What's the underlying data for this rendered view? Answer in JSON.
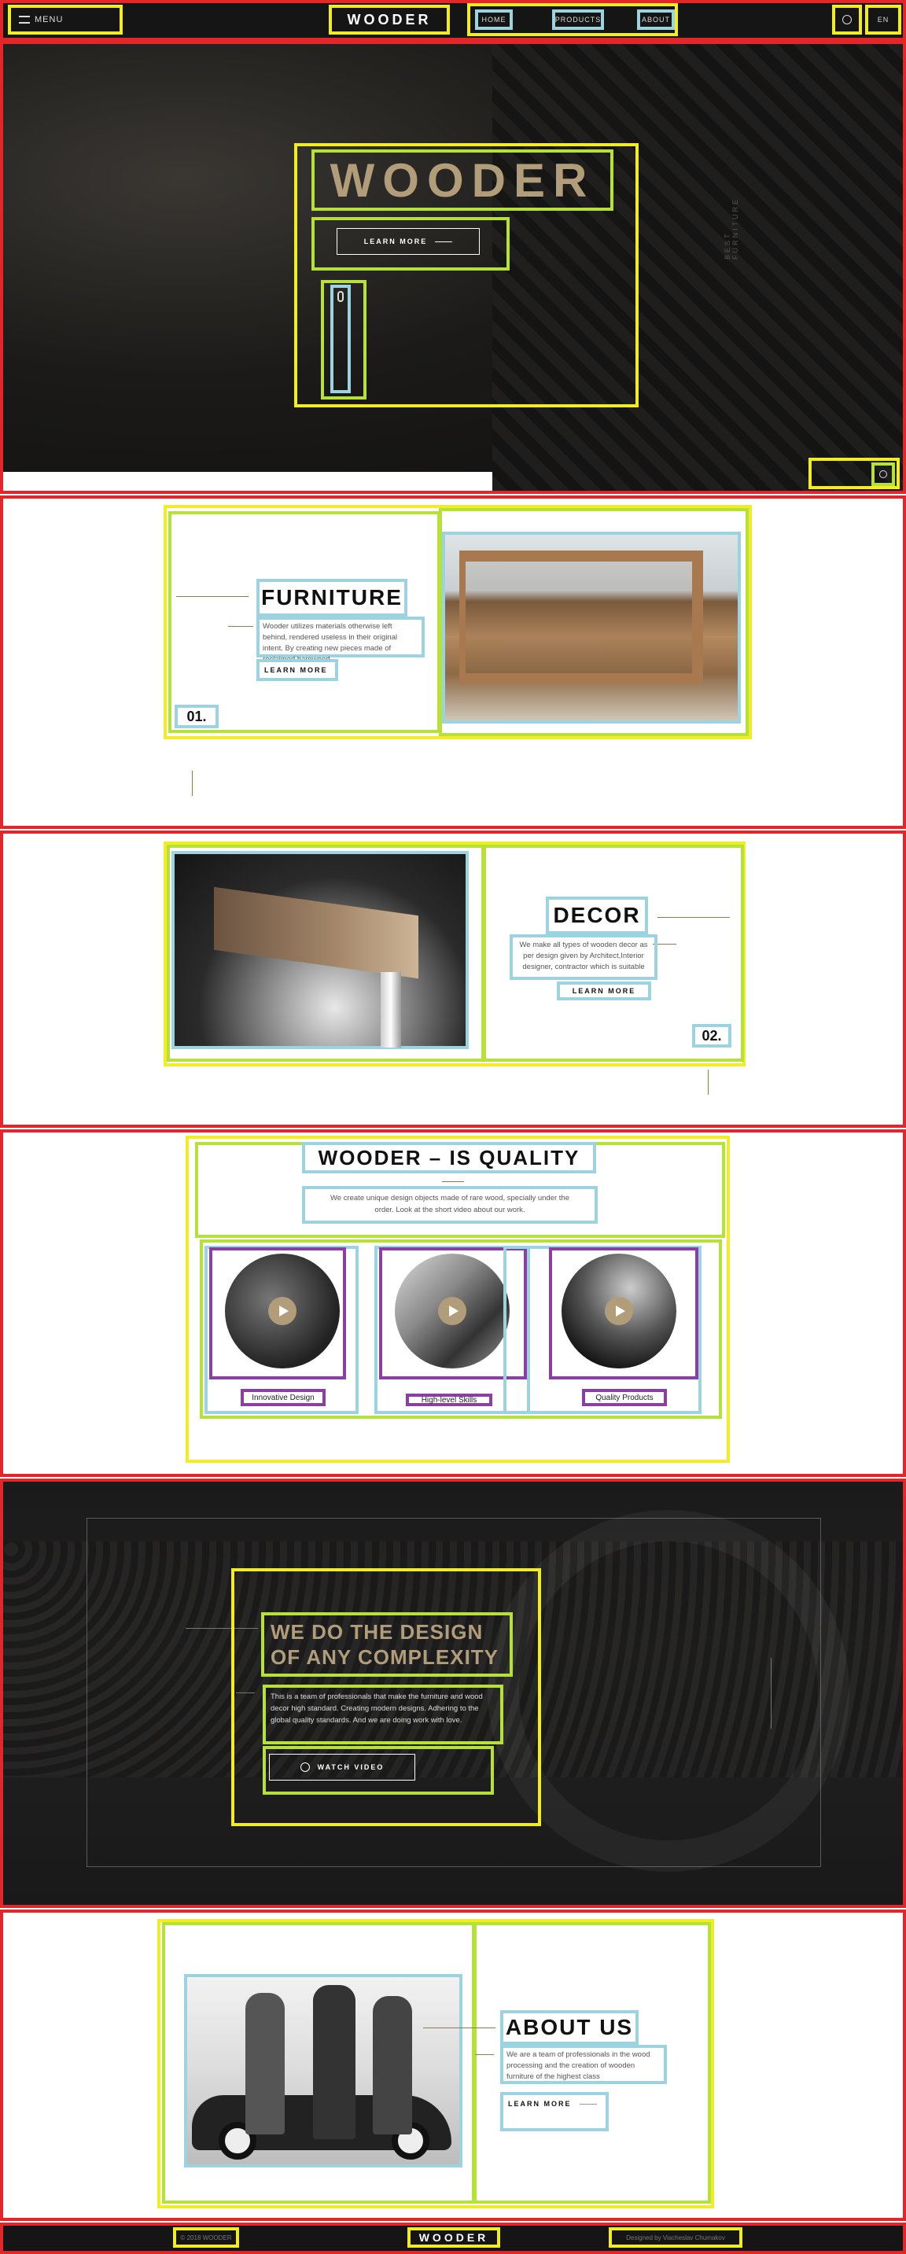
{
  "header": {
    "menu_label": "MENU",
    "logo": "WOODER",
    "nav": [
      "HOME",
      "PRODUCTS",
      "ABOUT"
    ],
    "lang": "EN"
  },
  "hero": {
    "title": "WOODER",
    "cta": "LEARN MORE",
    "side_text": "BEST FURNITURE"
  },
  "furniture": {
    "title": "FURNITURE",
    "text": "Wooder utilizes materials otherwise left behind, rendered useless in their original intent. By creating new pieces made of reclaimed barnwood",
    "learn": "LEARN MORE",
    "num": "01."
  },
  "decor": {
    "title": "DECOR",
    "text": "We make all types of wooden decor as per design given by Architect,Interior designer, contractor which is suitable",
    "learn": "LEARN MORE",
    "num": "02."
  },
  "quality": {
    "title": "WOODER – IS QUALITY",
    "text": "We create unique design objects made of rare wood, specially under the order. Look at the short video about our work.",
    "items": [
      {
        "label": "Innovative Design"
      },
      {
        "label": "High-level Skills"
      },
      {
        "label": "Quality Products"
      }
    ]
  },
  "complex": {
    "title_line1": "WE DO THE DESIGN",
    "title_line2": "OF ANY COMPLEXITY",
    "text": "This is a team of professionals that make the furniture and wood decor high standard. Creating modern designs. Adhering to the global quality standards. And we are doing work with love.",
    "button": "WATCH VIDEO"
  },
  "about": {
    "title": "ABOUT US",
    "text": "We are a team of professionals in the wood processing and the creation of wooden furniture of the highest class",
    "learn": "LEARN MORE"
  },
  "footer": {
    "left": "© 2018 WOODER",
    "logo": "WOODER",
    "right": "Designed by Viacheslav Chumakov"
  },
  "colors": {
    "accent": "#b29d7a",
    "dark": "#151515"
  },
  "icons": [
    "menu-icon",
    "search-icon",
    "play-icon",
    "share-icon",
    "arrow-right-icon"
  ]
}
